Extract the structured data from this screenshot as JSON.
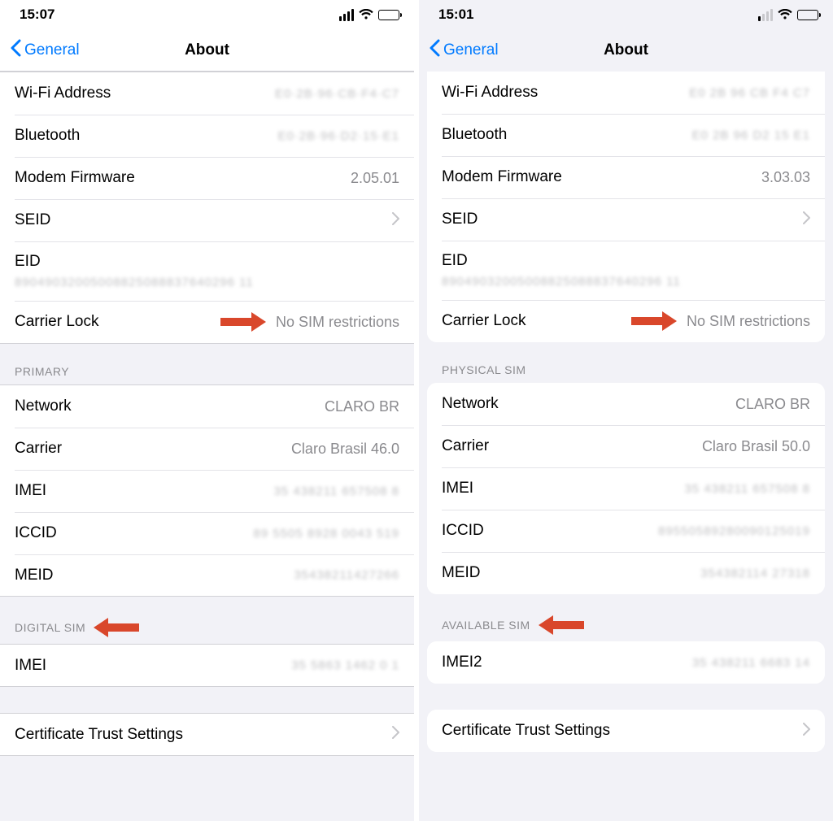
{
  "left": {
    "status": {
      "time": "15:07"
    },
    "nav": {
      "back": "General",
      "title": "About"
    },
    "rows1": {
      "wifi_label": "Wi-Fi Address",
      "wifi_value": "E0·2B·96·CB·F4·C7",
      "bt_label": "Bluetooth",
      "bt_value": "E0·2B·96·D2·15·E1",
      "modem_label": "Modem Firmware",
      "modem_value": "2.05.01",
      "seid_label": "SEID",
      "eid_label": "EID",
      "eid_value": "89049032005008825088837640296 11",
      "carrier_lock_label": "Carrier Lock",
      "carrier_lock_value": "No SIM restrictions"
    },
    "primary_header": "PRIMARY",
    "primary": {
      "network_label": "Network",
      "network_value": "CLARO BR",
      "carrier_label": "Carrier",
      "carrier_value": "Claro Brasil 46.0",
      "imei_label": "IMEI",
      "imei_value": "35 438211 657508 8",
      "iccid_label": "ICCID",
      "iccid_value": "89 5505 8928 0043 519",
      "meid_label": "MEID",
      "meid_value": "35438211427266"
    },
    "digital_sim_header": "DIGITAL SIM",
    "digital_sim": {
      "imei_label": "IMEI",
      "imei_value": "35 5863 1462 0 1"
    },
    "cert_label": "Certificate Trust Settings"
  },
  "right": {
    "status": {
      "time": "15:01"
    },
    "nav": {
      "back": "General",
      "title": "About"
    },
    "rows1": {
      "wifi_label": "Wi-Fi Address",
      "wifi_value": "E0 2B 96 CB F4 C7",
      "bt_label": "Bluetooth",
      "bt_value": "E0 2B 96 D2 15 E1",
      "modem_label": "Modem Firmware",
      "modem_value": "3.03.03",
      "seid_label": "SEID",
      "eid_label": "EID",
      "eid_value": "89049032005008825088837640296 11",
      "carrier_lock_label": "Carrier Lock",
      "carrier_lock_value": "No SIM restrictions"
    },
    "physical_sim_header": "PHYSICAL SIM",
    "physical": {
      "network_label": "Network",
      "network_value": "CLARO BR",
      "carrier_label": "Carrier",
      "carrier_value": "Claro Brasil 50.0",
      "imei_label": "IMEI",
      "imei_value": "35 438211 657508 8",
      "iccid_label": "ICCID",
      "iccid_value": "89550589280090125019",
      "meid_label": "MEID",
      "meid_value": "354382114 27318"
    },
    "available_sim_header": "AVAILABLE SIM",
    "available": {
      "imei2_label": "IMEI2",
      "imei2_value": "35 438211 6683 14"
    },
    "cert_label": "Certificate Trust Settings"
  }
}
